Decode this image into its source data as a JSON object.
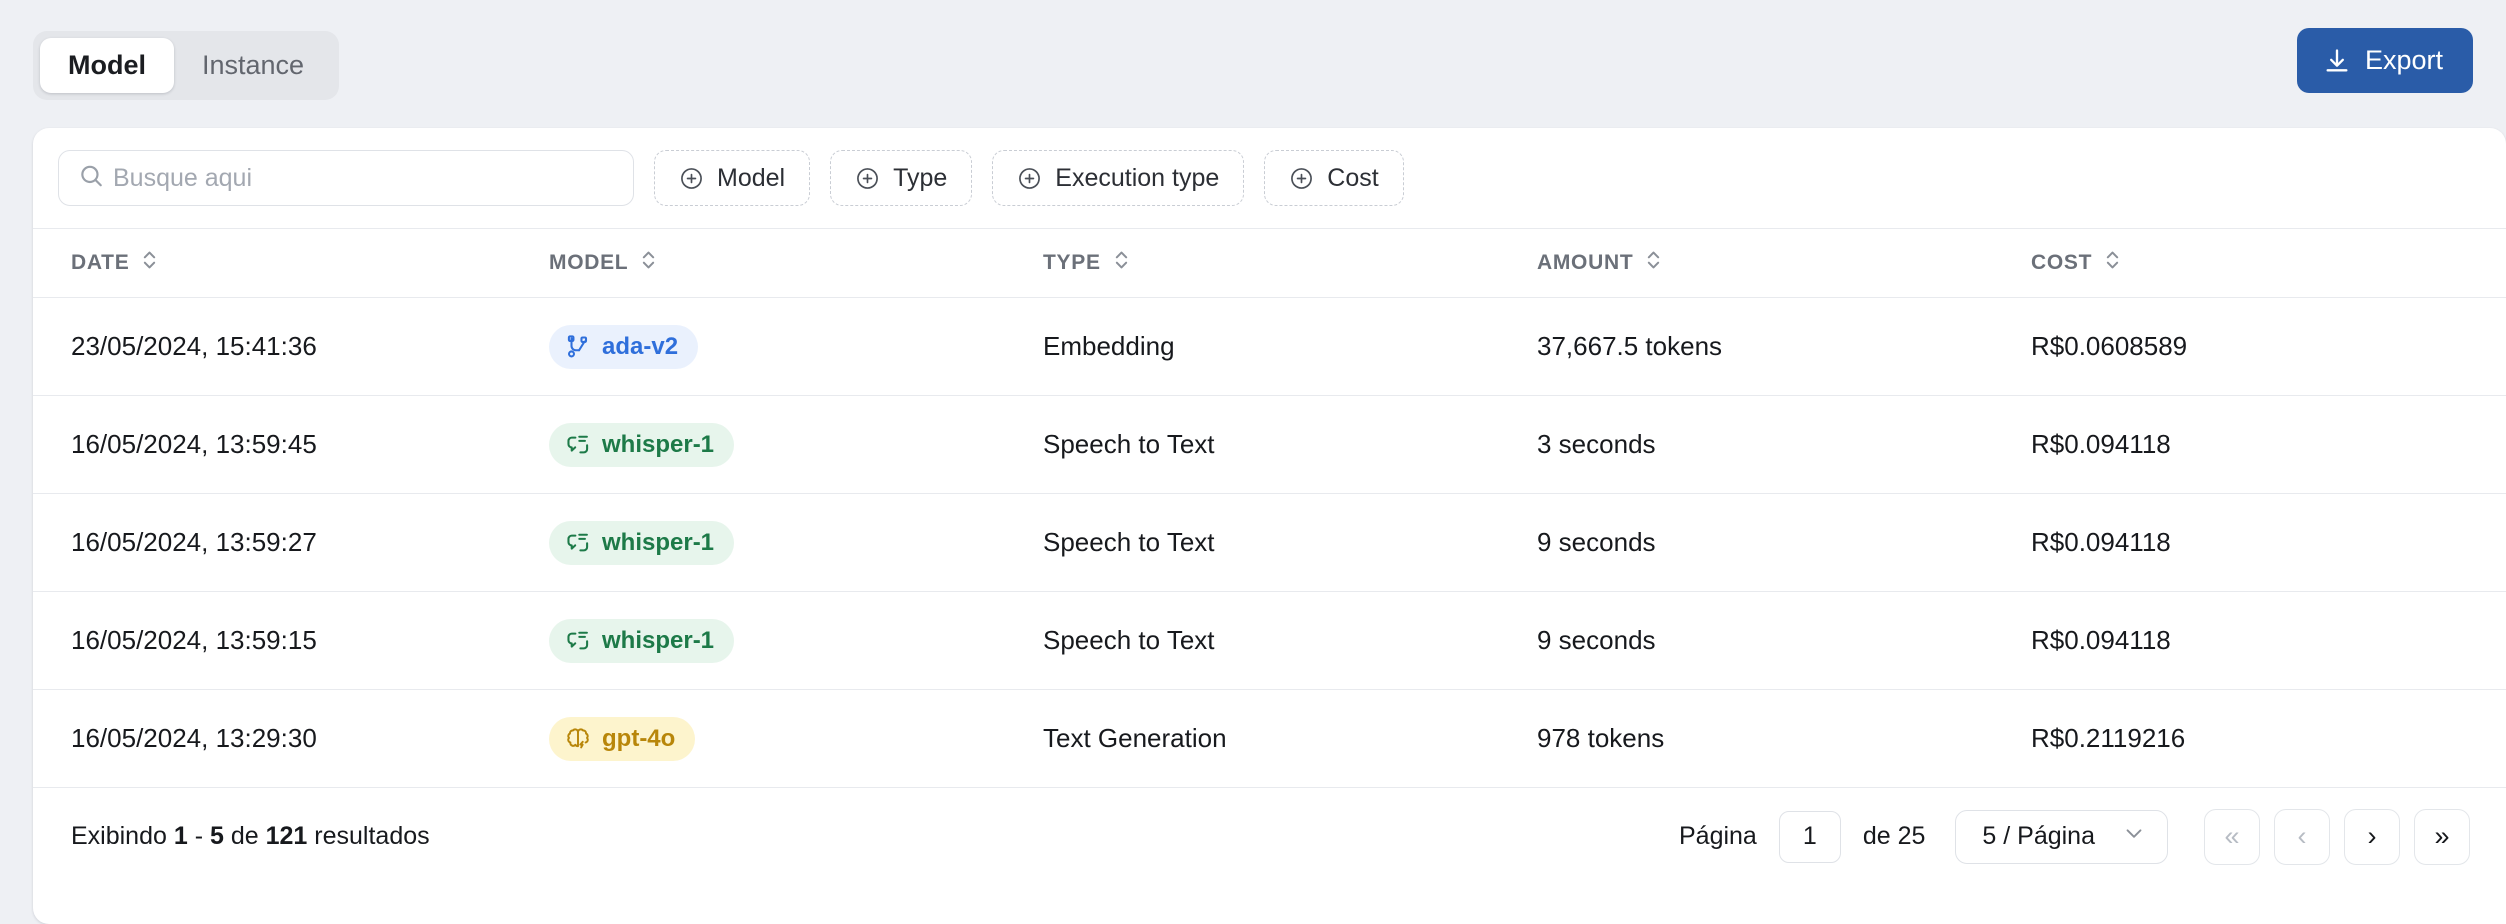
{
  "tabs": {
    "items": [
      {
        "label": "Model",
        "active": true
      },
      {
        "label": "Instance",
        "active": false
      }
    ]
  },
  "export": {
    "label": "Export",
    "color": "#2a5ca8"
  },
  "search": {
    "placeholder": "Busque aqui",
    "value": ""
  },
  "filters": [
    {
      "label": "Model"
    },
    {
      "label": "Type"
    },
    {
      "label": "Execution type"
    },
    {
      "label": "Cost"
    }
  ],
  "table": {
    "columns": [
      {
        "label": "DATE",
        "sortable": true
      },
      {
        "label": "MODEL",
        "sortable": true
      },
      {
        "label": "TYPE",
        "sortable": true
      },
      {
        "label": "AMOUNT",
        "sortable": true
      },
      {
        "label": "COST",
        "sortable": true
      }
    ],
    "rows": [
      {
        "date": "23/05/2024, 15:41:36",
        "model": "ada-v2",
        "model_style": "blue",
        "model_icon": "branch-icon",
        "type": "Embedding",
        "amount": "37,667.5 tokens",
        "cost": "R$0.0608589"
      },
      {
        "date": "16/05/2024, 13:59:45",
        "model": "whisper-1",
        "model_style": "green",
        "model_icon": "transcript-icon",
        "type": "Speech to Text",
        "amount": "3 seconds",
        "cost": "R$0.094118"
      },
      {
        "date": "16/05/2024, 13:59:27",
        "model": "whisper-1",
        "model_style": "green",
        "model_icon": "transcript-icon",
        "type": "Speech to Text",
        "amount": "9 seconds",
        "cost": "R$0.094118"
      },
      {
        "date": "16/05/2024, 13:59:15",
        "model": "whisper-1",
        "model_style": "green",
        "model_icon": "transcript-icon",
        "type": "Speech to Text",
        "amount": "9 seconds",
        "cost": "R$0.094118"
      },
      {
        "date": "16/05/2024, 13:29:30",
        "model": "gpt-4o",
        "model_style": "amber",
        "model_icon": "brain-icon",
        "type": "Text Generation",
        "amount": "978 tokens",
        "cost": "R$0.2119216"
      }
    ]
  },
  "footer": {
    "showing_prefix": "Exibindo",
    "showing_from": "1",
    "showing_dash": "-",
    "showing_to": "5",
    "showing_of": "de",
    "showing_total": "121",
    "showing_suffix": "resultados",
    "page_label": "Página",
    "page_value": "1",
    "page_of": "de 25",
    "per_page": "5 / Página",
    "nav": {
      "first": "«",
      "prev": "‹",
      "next": "›",
      "last": "»"
    }
  },
  "badge_colors": {
    "blue_bg": "#eaf1fd",
    "blue_fg": "#2f6fdb",
    "green_bg": "#e7f5ec",
    "green_fg": "#1d7a48",
    "amber_bg": "#fdf4cd",
    "amber_fg": "#b8860a"
  }
}
